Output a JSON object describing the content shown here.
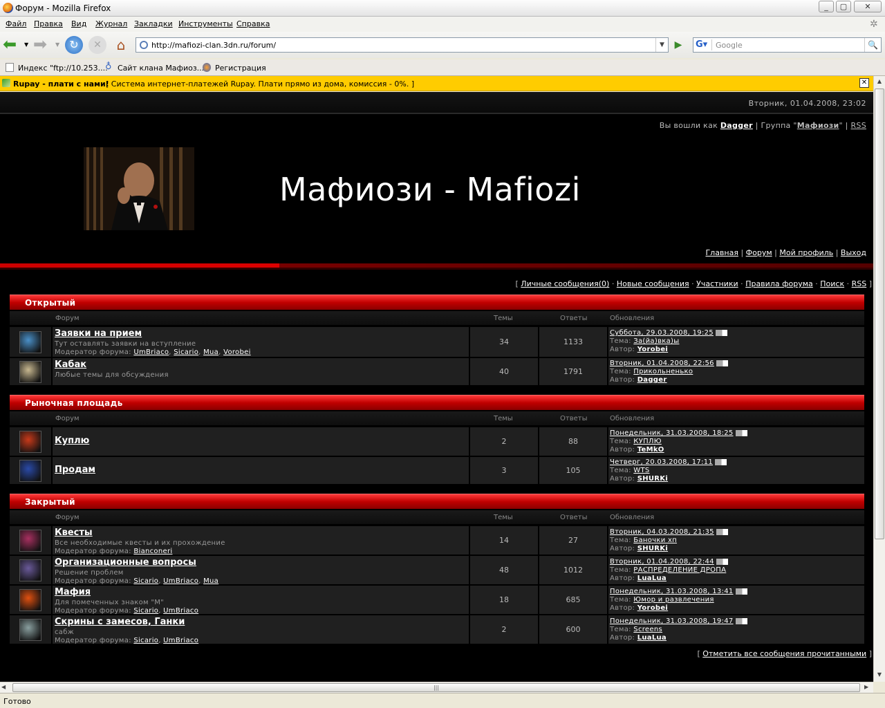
{
  "window": {
    "title": "Форум - Mozilla Firefox"
  },
  "menu": [
    "Файл",
    "Правка",
    "Вид",
    "Журнал",
    "Закладки",
    "Инструменты",
    "Справка"
  ],
  "nav": {
    "url": "http://mafiozi-clan.3dn.ru/forum/",
    "search_placeholder": "Google"
  },
  "bookmarks": [
    "Индекс \"ftp://10.253....",
    "Сайт клана Мафиоз...",
    "Регистрация"
  ],
  "rupay": {
    "title": "Rupay - плати с нами!",
    "text": "[ Система интернет-платежей Rupay. Плати прямо из дома, комиссия - 0%. ]"
  },
  "header": {
    "datetime": "Вторник, 01.04.2008, 23:02",
    "login_prefix": "Вы вошли как",
    "user": "Dagger",
    "group_prefix": "| Группа \"",
    "group": "Мафиози",
    "group_suffix": "\" |",
    "rss": "RSS",
    "site_title": "Мафиози - Mafiozi"
  },
  "topnav": [
    "Главная",
    "Форум",
    "Мой профиль",
    "Выход"
  ],
  "subnav": [
    "Личные сообщения(0)",
    "Новые сообщения",
    "Участники",
    "Правила форума",
    "Поиск",
    "RSS"
  ],
  "columns": {
    "forum": "Форум",
    "topics": "Темы",
    "replies": "Ответы",
    "updates": "Обновления"
  },
  "labels": {
    "moderator": "Модератор форума:",
    "topic": "Тема:",
    "author": "Автор:"
  },
  "sections": [
    {
      "name": "Открытый",
      "forums": [
        {
          "name": "Заявки на прием",
          "desc": "Тут оставлять заявки на вступление",
          "mods": [
            "UmBriaco",
            "Sicario",
            "Mua",
            "Vorobei"
          ],
          "topics": "34",
          "replies": "1133",
          "date": "Суббота, 29.03.2008, 19:25",
          "topic": "За(йа)вка)ы",
          "author": "Yorobei",
          "icon": "#4a90c8"
        },
        {
          "name": "Кабак",
          "desc": "Любые темы для обсуждения",
          "mods": [],
          "topics": "40",
          "replies": "1791",
          "date": "Вторник, 01.04.2008, 22:56",
          "topic": "Прикольненько",
          "author": "Dagger",
          "icon": "#c8b890"
        }
      ]
    },
    {
      "name": "Рыночная площадь",
      "forums": [
        {
          "name": "Куплю",
          "desc": "",
          "mods": [],
          "topics": "2",
          "replies": "88",
          "date": "Понедельник, 31.03.2008, 18:25",
          "topic": "КУПЛЮ",
          "author": "TeMkO",
          "icon": "#c83a1a"
        },
        {
          "name": "Продам",
          "desc": "",
          "mods": [],
          "topics": "3",
          "replies": "105",
          "date": "Четверг, 20.03.2008, 17:11",
          "topic": "WTS",
          "author": "SHURKi",
          "icon": "#2a4aa8"
        }
      ]
    },
    {
      "name": "Закрытый",
      "forums": [
        {
          "name": "Квесты",
          "desc": "Все необходимые квесты и их прохождение",
          "mods": [
            "Bianconeri"
          ],
          "topics": "14",
          "replies": "27",
          "date": "Вторник, 04.03.2008, 21:35",
          "topic": "Баночки хп",
          "author": "SHURKi",
          "icon": "#a83060"
        },
        {
          "name": "Организационные вопросы",
          "desc": "Решение проблем",
          "mods": [
            "Sicario",
            "UmBriaco",
            "Mua"
          ],
          "topics": "48",
          "replies": "1012",
          "date": "Вторник, 01.04.2008, 22:44",
          "topic": "РАСПРЕДЕЛЕНИЕ ДРОПА",
          "author": "LuaLua",
          "icon": "#6a5a9a"
        },
        {
          "name": "Мафия",
          "desc": "Для помеченных знаком \"М\"",
          "mods": [
            "Sicario",
            "UmBriaco"
          ],
          "topics": "18",
          "replies": "685",
          "date": "Понедельник, 31.03.2008, 13:41",
          "topic": "Юмор и развлечения",
          "author": "Yorobei",
          "icon": "#e05010"
        },
        {
          "name": "Скрины с замесов, Ганки",
          "desc": "сабж",
          "mods": [
            "Sicario",
            "UmBriaco"
          ],
          "topics": "2",
          "replies": "600",
          "date": "Понедельник, 31.03.2008, 19:47",
          "topic": "Screens",
          "author": "LuaLua",
          "icon": "#8aa0a0"
        }
      ]
    }
  ],
  "markall": "Отметить все сообщения прочитанными",
  "status": "Готово"
}
